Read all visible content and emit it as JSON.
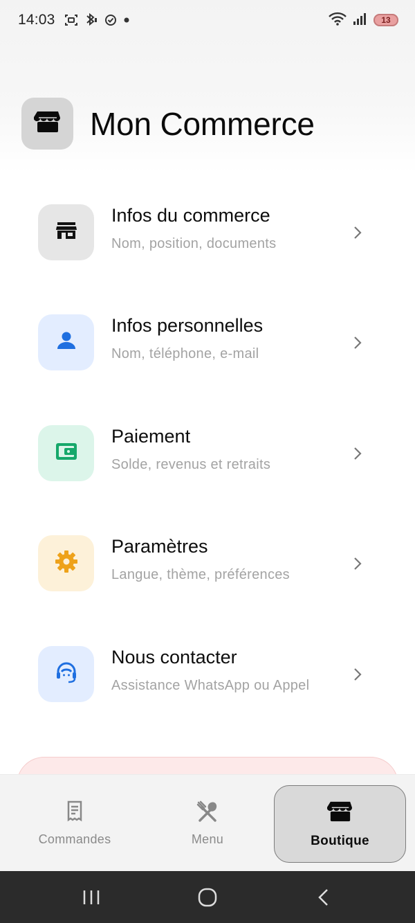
{
  "status_bar": {
    "time": "14:03",
    "battery_level": "13",
    "icons": [
      "screenshot-icon",
      "bluetooth-audio-icon",
      "sync-check-icon",
      "notification-dot-icon",
      "wifi-icon",
      "signal-icon",
      "battery-icon"
    ]
  },
  "header": {
    "title": "Mon Commerce",
    "logo_icon": "store-icon"
  },
  "menu": {
    "items": [
      {
        "title": "Infos du commerce",
        "subtitle": "Nom, position, documents",
        "icon": "store-icon",
        "bg": "#e6e6e6",
        "fg": "#111111"
      },
      {
        "title": "Infos personnelles",
        "subtitle": "Nom, téléphone, e-mail",
        "icon": "person-icon",
        "bg": "#e3edff",
        "fg": "#1f6fe0"
      },
      {
        "title": "Paiement",
        "subtitle": "Solde, revenus et retraits",
        "icon": "wallet-icon",
        "bg": "#dcf5ea",
        "fg": "#16a86b"
      },
      {
        "title": "Paramètres",
        "subtitle": "Langue, thème, préférences",
        "icon": "gear-icon",
        "bg": "#fdf1d9",
        "fg": "#eea21a"
      },
      {
        "title": "Nous contacter",
        "subtitle": "Assistance WhatsApp ou Appel",
        "icon": "support-agent-icon",
        "bg": "#e3edff",
        "fg": "#1f6fe0"
      }
    ]
  },
  "bottom_nav": {
    "tabs": [
      {
        "label": "Commandes",
        "icon": "receipt-icon",
        "active": false
      },
      {
        "label": "Menu",
        "icon": "fork-knife-icon",
        "active": false
      },
      {
        "label": "Boutique",
        "icon": "store-icon",
        "active": true
      }
    ]
  },
  "system_nav": {
    "buttons": [
      "recent-apps-icon",
      "home-icon",
      "back-icon"
    ]
  }
}
